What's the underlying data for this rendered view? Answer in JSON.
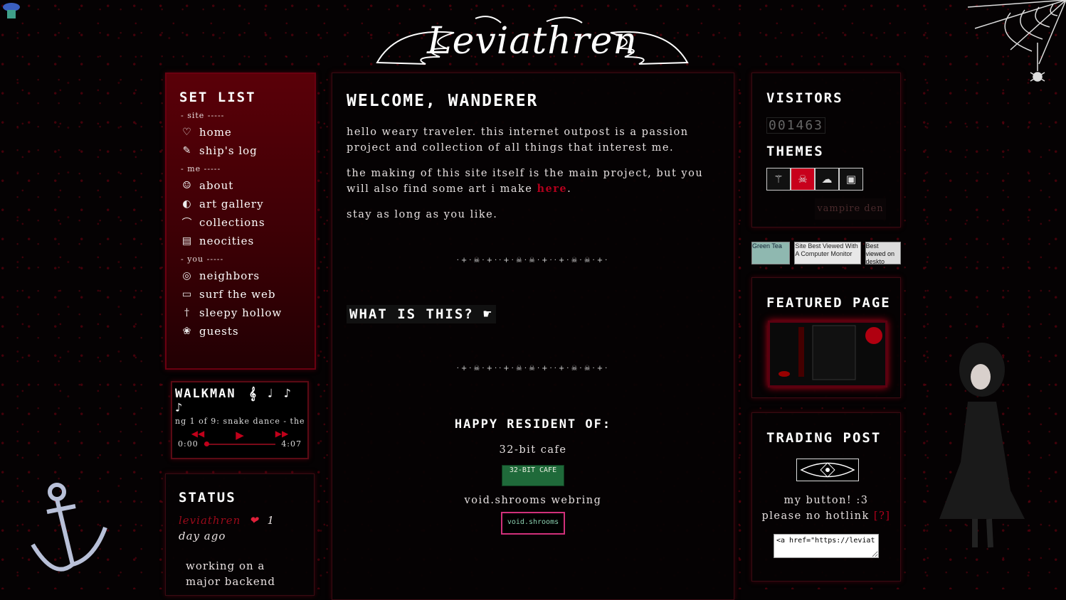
{
  "colors": {
    "accent_red": "#c0001a",
    "panel_red": "#5a0008",
    "background": "#050203"
  },
  "logo": {
    "text": "Leviathren"
  },
  "setlist": {
    "title": "SET LIST",
    "sections": [
      {
        "header": "- site -----",
        "items": [
          {
            "label": "home",
            "icon": "heart-icon",
            "glyph": "♡"
          },
          {
            "label": "ship's log",
            "icon": "book-icon",
            "glyph": "✎"
          }
        ]
      },
      {
        "header": "- me -----",
        "items": [
          {
            "label": "about",
            "icon": "person-icon",
            "glyph": "☺"
          },
          {
            "label": "art gallery",
            "icon": "palette-icon",
            "glyph": "◐"
          },
          {
            "label": "collections",
            "icon": "shelf-icon",
            "glyph": "⌒"
          },
          {
            "label": "neocities",
            "icon": "computer-icon",
            "glyph": "▤"
          }
        ]
      },
      {
        "header": "- you -----",
        "items": [
          {
            "label": "neighbors",
            "icon": "spiral-icon",
            "glyph": "◎"
          },
          {
            "label": "surf the web",
            "icon": "laptop-icon",
            "glyph": "▭"
          },
          {
            "label": "sleepy hollow",
            "icon": "cross-icon",
            "glyph": "†"
          },
          {
            "label": "guests",
            "icon": "flower-icon",
            "glyph": "❀"
          }
        ]
      }
    ]
  },
  "walkman": {
    "title": "WALKMAN",
    "notes": "𝄞 ♩ ♪ ♪",
    "track": "ng 1 of 9: snake dance - the",
    "time_current": "0:00",
    "time_total": "4:07",
    "progress": 0,
    "prev_glyph": "◀◀",
    "play_glyph": "▶",
    "next_glyph": "▶▶"
  },
  "status": {
    "title": "STATUS",
    "user": "leviathren",
    "heart": "❤",
    "time": "1 day ago",
    "message": "working on a major backend"
  },
  "main": {
    "welcome_title": "WELCOME, WANDERER",
    "intro_p1": "hello weary traveler. this internet outpost is a passion project and collection of all things that interest me.",
    "intro_p2_prefix": "the making of this site itself is the main project, but you will also find some art i make ",
    "intro_p2_link": "here",
    "intro_p2_suffix": ".",
    "intro_p3": "stay as long as you like.",
    "divider": "·+·☠·+··+·☠·☠·+··+·☠·☠·+·",
    "what_title": "WHAT IS THIS?",
    "what_arrow": "☛",
    "resident_title": "HAPPY RESIDENT OF:",
    "residencies": [
      {
        "name": "32-bit cafe",
        "badge": "32-BIT CAFE"
      },
      {
        "name": "void.shrooms webring",
        "badge": "void.shrooms"
      }
    ]
  },
  "visitors": {
    "title": "VISITORS",
    "count": "001463"
  },
  "themes": {
    "title": "THEMES",
    "options": [
      {
        "icon": "wand-icon",
        "glyph": "⚚"
      },
      {
        "icon": "vampire-icon",
        "glyph": "☠",
        "active": true
      },
      {
        "icon": "cat-icon",
        "glyph": "☁"
      },
      {
        "icon": "computer-icon",
        "glyph": "▣"
      }
    ],
    "tooltip": "vampire den"
  },
  "banner_buttons": [
    {
      "text": "Green Tea",
      "bg": "#8fb8b0",
      "fg": "#123"
    },
    {
      "text": "Site Best Viewed With A Computer Monitor",
      "bg": "#e8e8e8",
      "fg": "#222"
    },
    {
      "text": "Best viewed on deskto",
      "bg": "#dcdcdc",
      "fg": "#111"
    }
  ],
  "featured": {
    "title": "FEATURED PAGE"
  },
  "trading": {
    "title": "TRADING POST",
    "line1": "my button! :3",
    "line2": "please no hotlink",
    "hint": "[?]",
    "code": "<a href=\"https://leviat"
  }
}
